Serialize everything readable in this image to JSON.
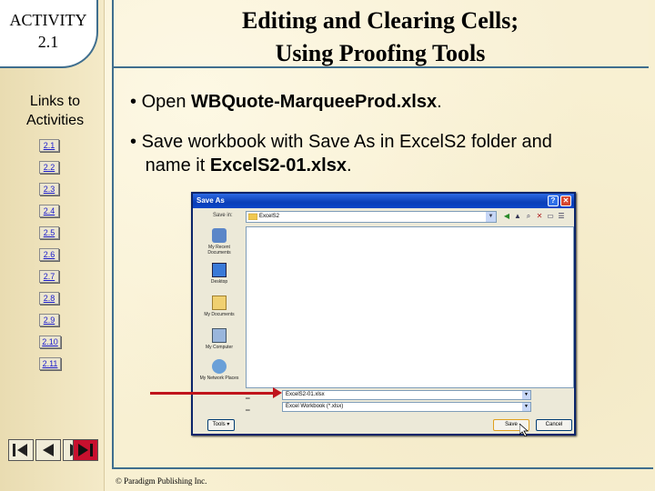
{
  "activity": {
    "line1": "ACTIVITY",
    "line2": "2.1"
  },
  "title": {
    "line1": "Editing and Clearing Cells;",
    "line2": "Using Proofing Tools"
  },
  "links": {
    "title_line1": "Links to",
    "title_line2": "Activities",
    "items": [
      "2.1",
      "2.2",
      "2.3",
      "2.4",
      "2.5",
      "2.6",
      "2.7",
      "2.8",
      "2.9",
      "2.10",
      "2.11"
    ]
  },
  "bullets": [
    {
      "pre": "Open ",
      "bold": "WBQuote-MarqueeProd.xlsx",
      "post": "."
    },
    {
      "pre": "Save workbook with Save As in ExcelS2 folder and",
      "line2_pre": "name it ",
      "bold": "ExcelS2-01.xlsx",
      "post": "."
    }
  ],
  "dialog": {
    "title": "Save As",
    "save_in_label": "Save in:",
    "save_in_value": "ExcelS2",
    "places": [
      "My Recent Documents",
      "Desktop",
      "My Documents",
      "My Computer",
      "My Network Places"
    ],
    "file_name_value": "ExcelS2-01.xlsx",
    "save_as_type_value": "Excel Workbook (*.xlsx)",
    "tools_label": "Tools",
    "save_label": "Save",
    "cancel_label": "Cancel"
  },
  "footer": {
    "text": "© Paradigm Publishing Inc."
  },
  "nav_icons": [
    "first-page-icon",
    "previous-page-icon",
    "next-page-icon",
    "last-page-icon"
  ],
  "colors": {
    "frame": "#3f6e8e",
    "arrow": "#c0141c",
    "background": "#f8f0d2"
  }
}
